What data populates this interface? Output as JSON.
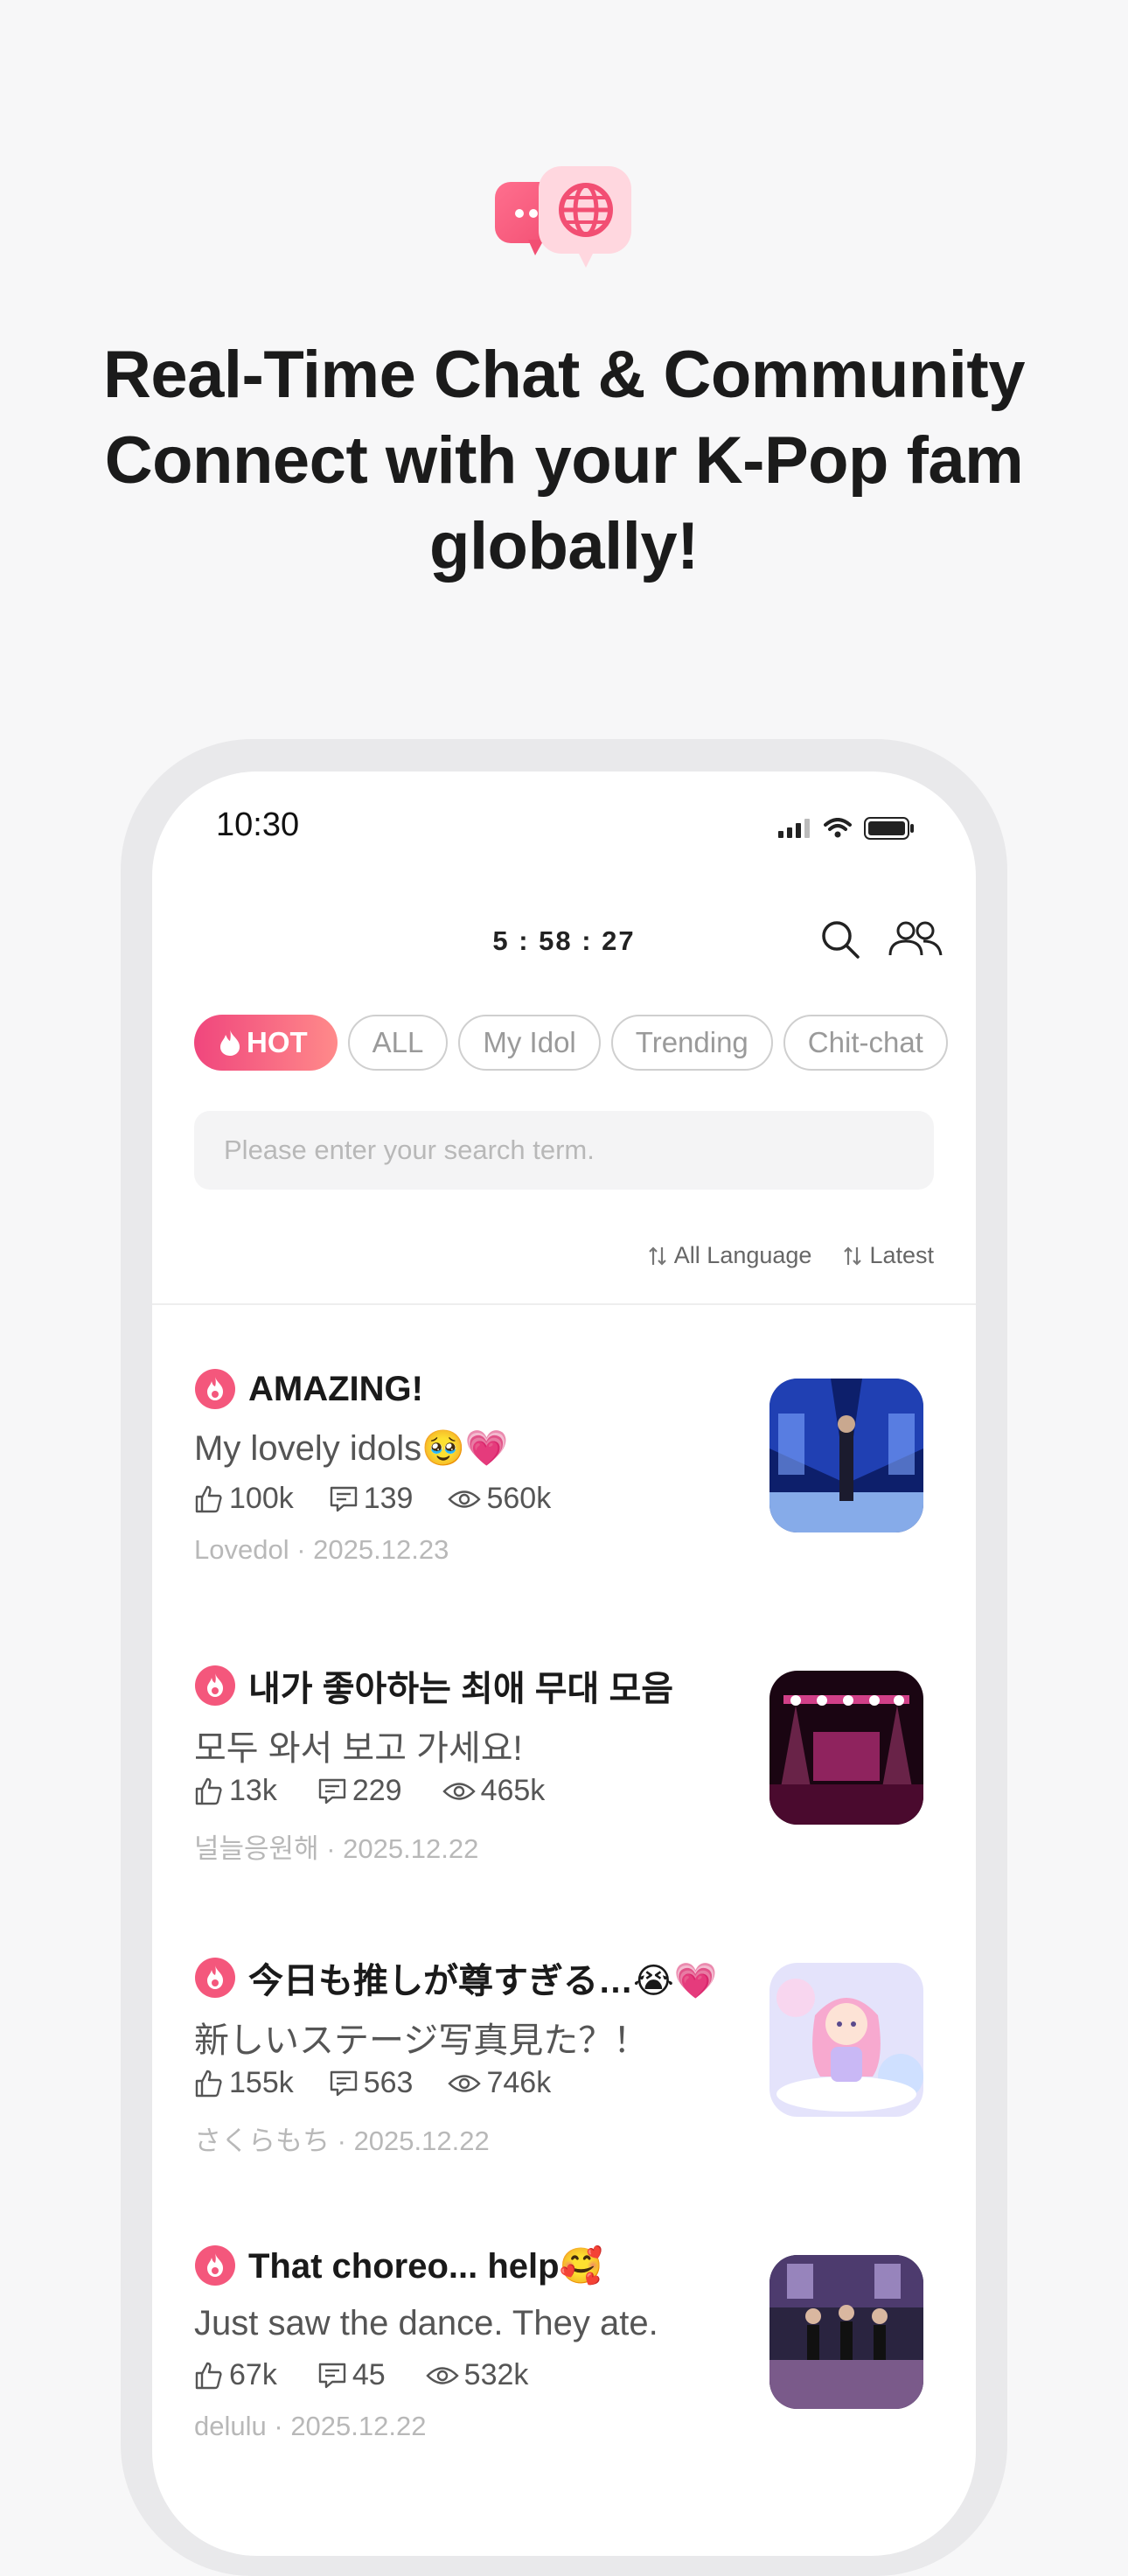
{
  "hero": {
    "headline_lines": [
      "Real-Time Chat & Community",
      "Connect with your K-Pop fam",
      "globally!"
    ]
  },
  "status_bar": {
    "time": "10:30"
  },
  "header": {
    "timer": "5 : 58 : 27"
  },
  "categories": [
    {
      "label": "HOT",
      "active": true
    },
    {
      "label": "ALL",
      "active": false
    },
    {
      "label": "My Idol",
      "active": false
    },
    {
      "label": "Trending",
      "active": false
    },
    {
      "label": "Chit-chat",
      "active": false
    }
  ],
  "search": {
    "placeholder": "Please enter your search term."
  },
  "filters": {
    "language": "All Language",
    "sort": "Latest"
  },
  "posts": [
    {
      "title": "AMAZING!",
      "body": "My lovely idols🥹💗",
      "likes": "100k",
      "comments": "139",
      "views": "560k",
      "author": "Lovedol",
      "date": "2025.12.23",
      "thumb": "concert-stage-blue"
    },
    {
      "title": "내가 좋아하는 최애 무대 모음",
      "body": "모두 와서 보고 가세요!",
      "likes": "13k",
      "comments": "229",
      "views": "465k",
      "author": "널늘응원해",
      "date": "2025.12.22",
      "thumb": "concert-stage-pink"
    },
    {
      "title": "今日も推しが尊すぎる…😭💗",
      "body": "新しいステージ写真見た？！",
      "likes": "155k",
      "comments": "563",
      "views": "746k",
      "author": "さくらもち",
      "date": "2025.12.22",
      "thumb": "anime-idol-pastel"
    },
    {
      "title": "That choreo... help🥰",
      "body": "Just saw the dance. They ate.",
      "likes": "67k",
      "comments": "45",
      "views": "532k",
      "author": "delulu",
      "date": "2025.12.22",
      "thumb": "dance-practice"
    }
  ],
  "colors": {
    "accent": "#f0467d",
    "accent_light": "#ff8a8a"
  }
}
